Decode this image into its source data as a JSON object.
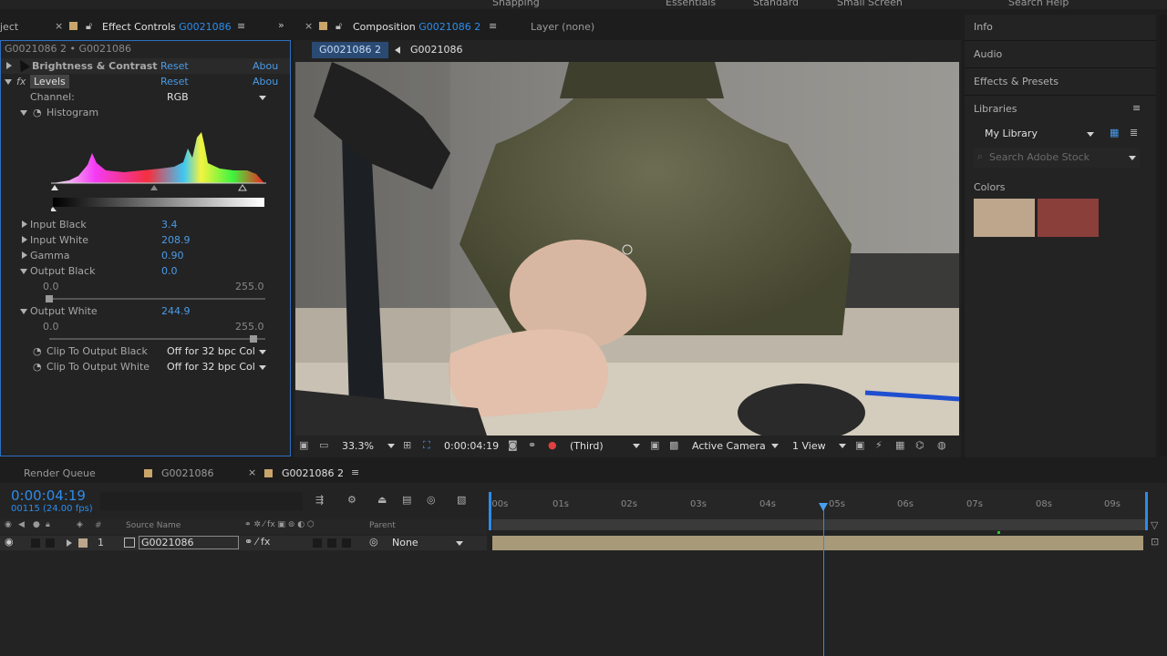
{
  "workspace": {
    "items": [
      "Snapping",
      "Essentials",
      "Standard",
      "Small Screen",
      "Search Help"
    ]
  },
  "effect_controls": {
    "left_tab_partial": "ject",
    "tab_title": "Effect Controls",
    "tab_layer": "G0021086",
    "breadcrumb": "G0021086 2 • G0021086",
    "effects": [
      {
        "name": "Brightness & Contrast",
        "reset": "Reset",
        "about": "Abou"
      },
      {
        "name": "Levels",
        "fx": "fx",
        "reset": "Reset",
        "about": "Abou"
      }
    ],
    "channel_label": "Channel:",
    "channel_value": "RGB",
    "histogram_label": "Histogram",
    "params": [
      {
        "label": "Input Black",
        "value": "3.4"
      },
      {
        "label": "Input White",
        "value": "208.9"
      },
      {
        "label": "Gamma",
        "value": "0.90"
      },
      {
        "label": "Output Black",
        "value": "0.0"
      },
      {
        "label": "Output White",
        "value": "244.9"
      }
    ],
    "output_black_slider": {
      "min": "0.0",
      "max": "255.0",
      "value": 0.0
    },
    "output_white_slider": {
      "min": "0.0",
      "max": "255.0",
      "value": 244.9
    },
    "clip_black_label": "Clip To Output Black",
    "clip_black_value": "Off for 32 bpc Col",
    "clip_white_label": "Clip To Output White",
    "clip_white_value": "Off for 32 bpc Col"
  },
  "composition": {
    "tab_prefix": "Composition",
    "tab_name": "G0021086 2",
    "layer_tab": "Layer (none)",
    "breadcrumb_active": "G0021086 2",
    "breadcrumb_next": "G0021086",
    "zoom": "33.3%",
    "timecode": "0:00:04:19",
    "resolution": "(Third)",
    "camera": "Active Camera",
    "views": "1 View"
  },
  "right_panel": {
    "info": "Info",
    "audio": "Audio",
    "effects_presets": "Effects & Presets",
    "libraries": "Libraries",
    "library_select": "My Library",
    "search_placeholder": "Search Adobe Stock",
    "colors_label": "Colors",
    "swatches": [
      "#bda68c",
      "#8a3f3b"
    ]
  },
  "timeline": {
    "tabs": [
      "Render Queue",
      "G0021086",
      "G0021086 2"
    ],
    "timecode": "0:00:04:19",
    "frame_info": "00115 (24.00 fps)",
    "columns": {
      "num": "#",
      "source": "Source Name",
      "parent": "Parent"
    },
    "layer": {
      "index": "1",
      "name": "G0021086",
      "parent": "None"
    },
    "ruler": ":00s|01s|02s|03s|04s|05s|06s|07s|08s|09s",
    "current_time_seconds": 4.8
  },
  "colors": {
    "accent": "#2d8ceb",
    "panel_bg": "#232323",
    "layer_bar": "#a89a78"
  }
}
